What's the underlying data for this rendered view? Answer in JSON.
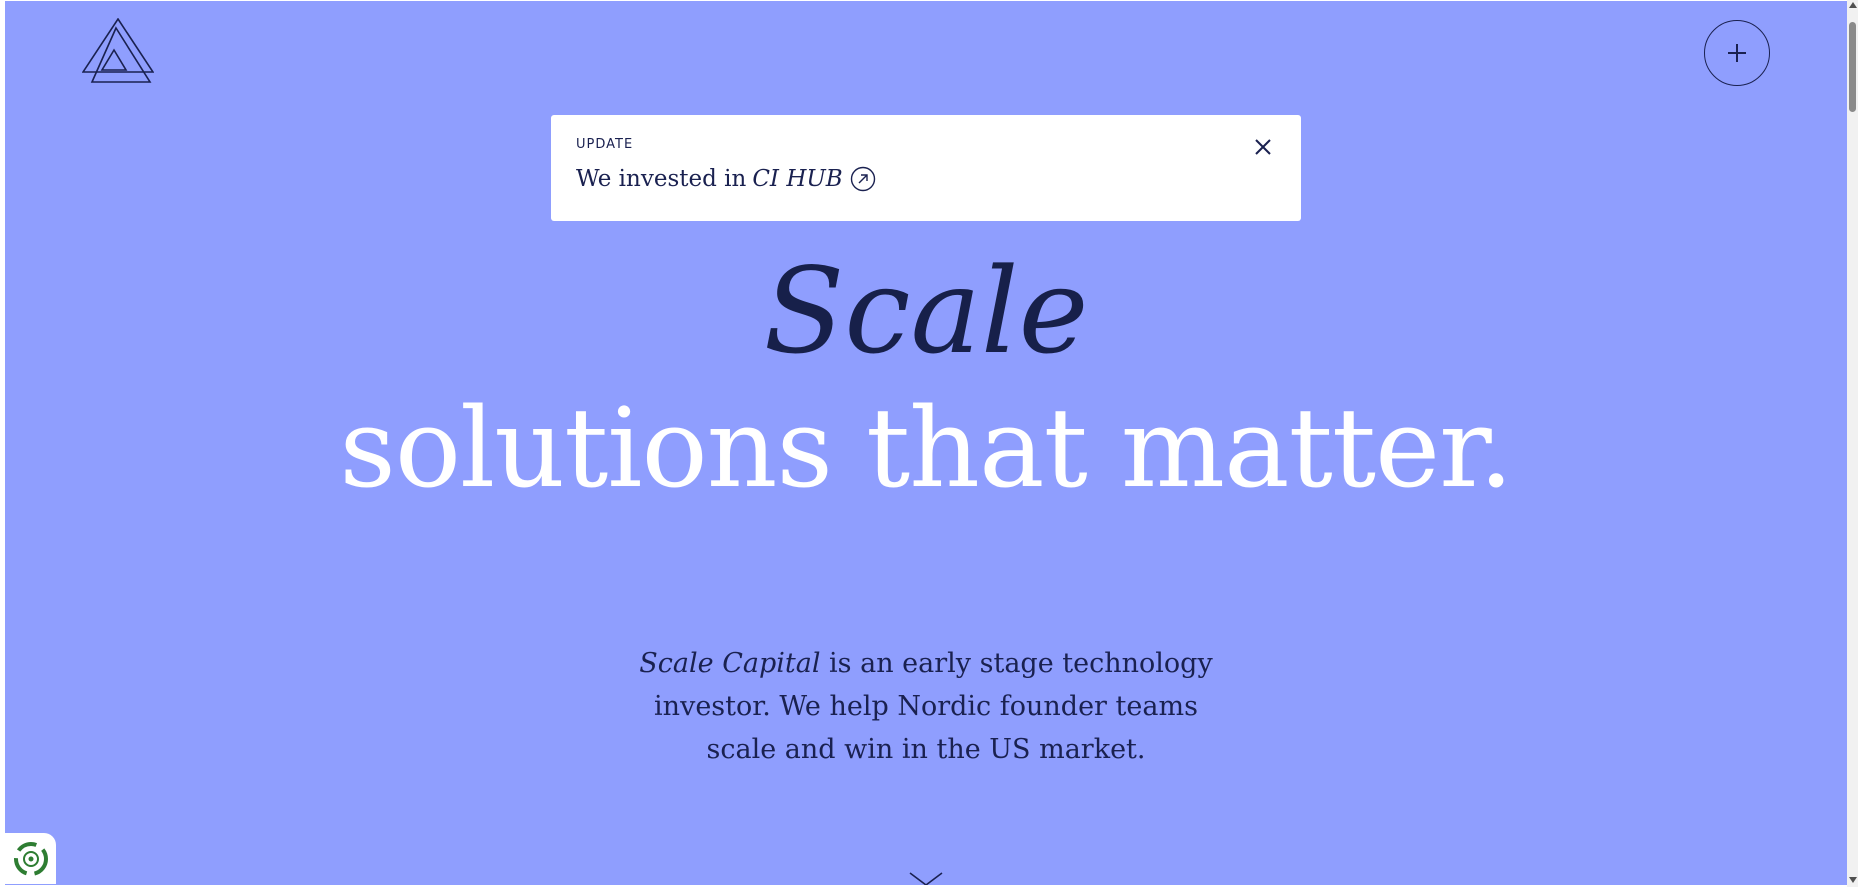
{
  "colors": {
    "background": "#8f9efe",
    "ink": "#1a2150",
    "hero_dark": "#17204a",
    "hero_light": "#ffffff",
    "panel": "#ffffff"
  },
  "header": {
    "logo_icon": "triangles-logo-icon",
    "menu_icon": "plus-icon"
  },
  "notice": {
    "label": "UPDATE",
    "text_prefix": "We invested in",
    "company": "CI HUB",
    "link_icon": "arrow-up-right-circle-icon",
    "close_icon": "close-icon"
  },
  "hero": {
    "line1": "Scale",
    "line2": "solutions that matter."
  },
  "description": {
    "company": "Scale Capital",
    "text": " is an early stage technology investor. We help Nordic founder teams scale and win in the US market."
  },
  "scroll_icon": "chevron-down-icon",
  "badge_icon": "recycle-badge-icon"
}
